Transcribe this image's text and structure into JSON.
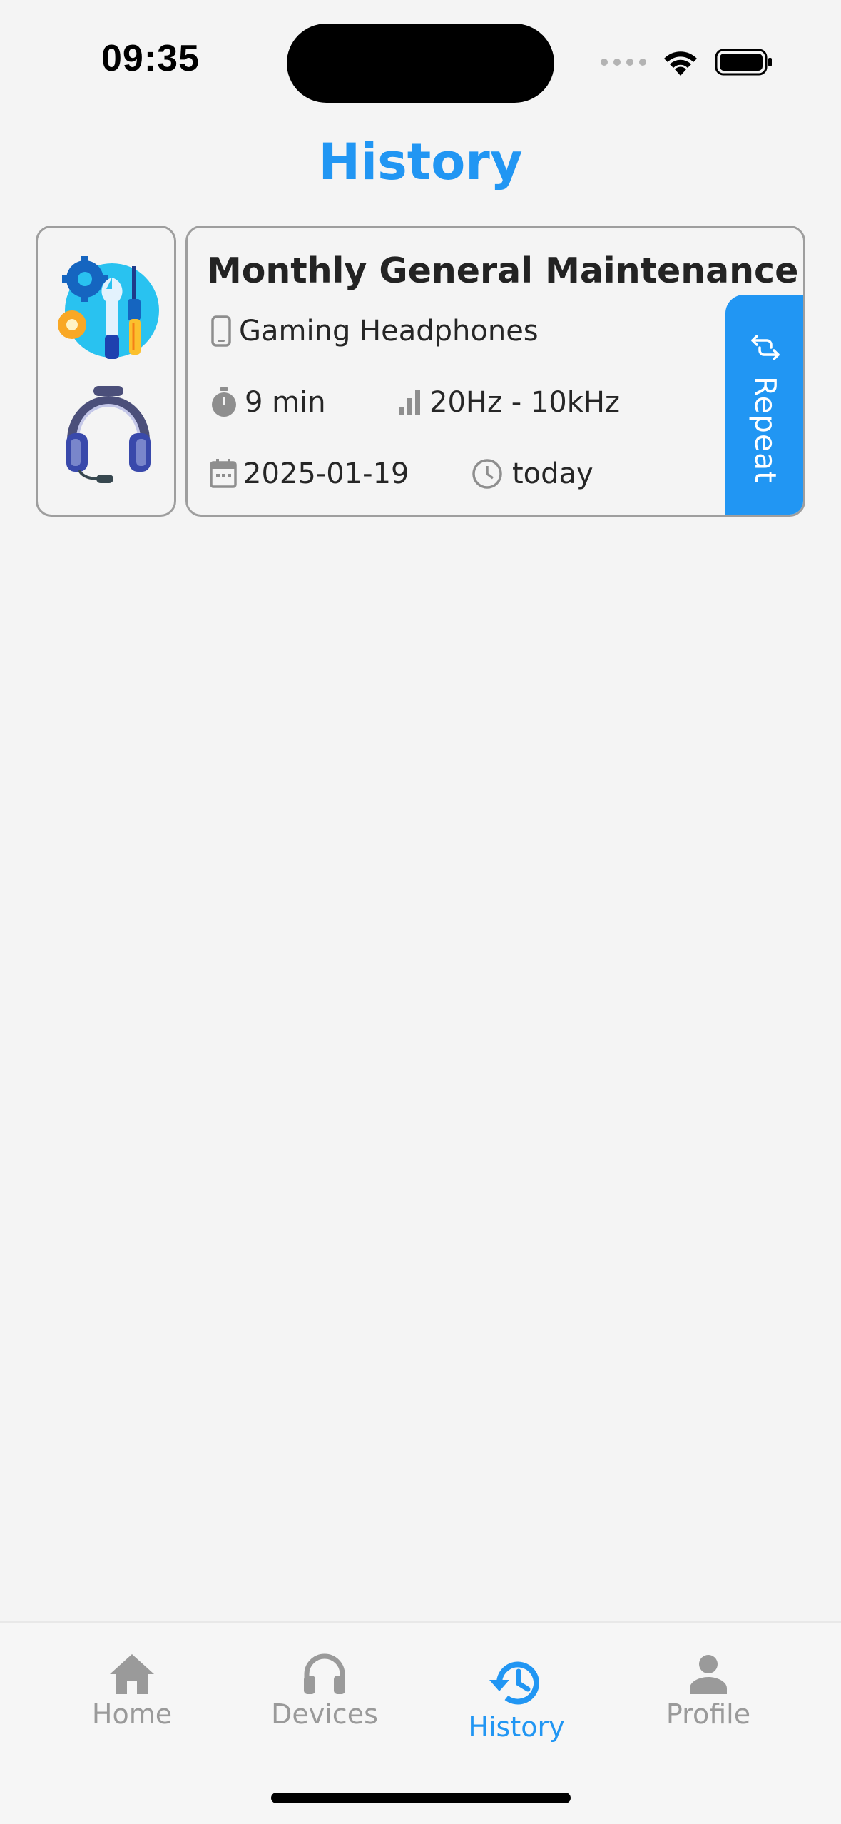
{
  "status_bar": {
    "time": "09:35"
  },
  "page": {
    "title": "History"
  },
  "history": [
    {
      "title": "Monthly General Maintenance",
      "device": "Gaming Headphones",
      "duration": "9 min",
      "frequency_range": "20Hz - 10kHz",
      "date": "2025-01-19",
      "time": "today",
      "repeat_label": "Repeat",
      "thumb_icons": [
        "maintenance-tools-icon",
        "gaming-headphones-icon"
      ]
    }
  ],
  "bottom_nav": {
    "items": [
      {
        "label": "Home",
        "icon": "home-icon",
        "active": false
      },
      {
        "label": "Devices",
        "icon": "headphones-icon",
        "active": false
      },
      {
        "label": "History",
        "icon": "history-icon",
        "active": true
      },
      {
        "label": "Profile",
        "icon": "person-icon",
        "active": false
      }
    ]
  },
  "colors": {
    "accent": "#2196f3",
    "background": "#f4f4f4",
    "border": "#9e9e9e",
    "inactive": "#9a9a9a",
    "text": "#262626"
  }
}
